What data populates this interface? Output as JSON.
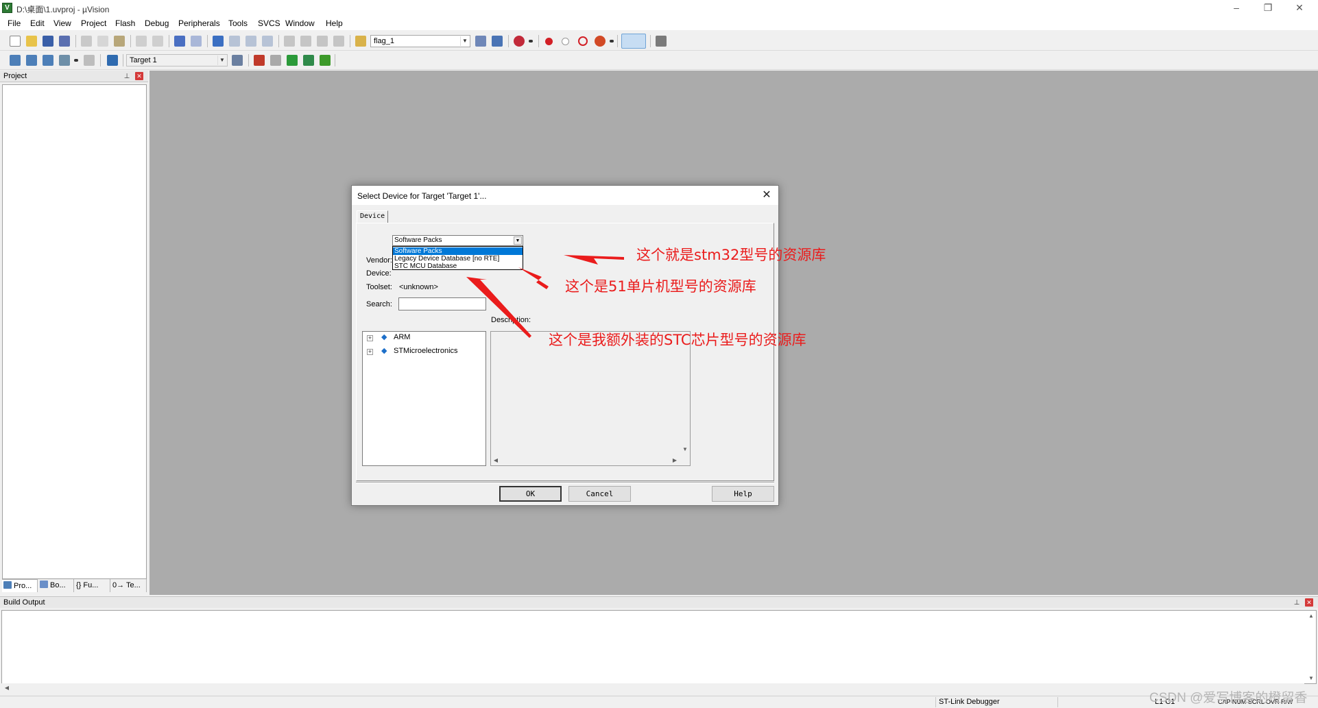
{
  "window": {
    "title": "D:\\桌面\\1.uvproj - µVision",
    "app_icon": "V",
    "controls": {
      "minimize": "–",
      "restore": "❐",
      "close": "✕"
    }
  },
  "menu": [
    "File",
    "Edit",
    "View",
    "Project",
    "Flash",
    "Debug",
    "Peripherals",
    "Tools",
    "SVCS",
    "Window",
    "Help"
  ],
  "toolbar1": {
    "find_combo": "flag_1"
  },
  "toolbar2": {
    "target_combo": "Target 1"
  },
  "project_pane": {
    "title": "Project",
    "tabs": [
      "Pro...",
      "Bo...",
      "{} Fu...",
      "0→ Te..."
    ]
  },
  "build_pane": {
    "title": "Build Output"
  },
  "status_bar": {
    "debugger": "ST-Link Debugger",
    "position": "L1 C1",
    "flags": "CAP  NUM  SCRL  OVR  R/W"
  },
  "dialog": {
    "title": "Select Device for Target 'Target 1'...",
    "tab": "Device",
    "packs_select_value": "Software Packs",
    "packs_options": [
      "Software Packs",
      "Legacy Device Database [no RTE]",
      "STC MCU Database"
    ],
    "selected_option_index": 0,
    "labels": {
      "vendor": "Vendor:",
      "device": "Device:",
      "toolset": "Toolset:",
      "toolset_value": "<unknown>",
      "search": "Search:",
      "description": "Description:"
    },
    "search_value": "",
    "tree": [
      {
        "label": "ARM",
        "icon": "diamond-icon"
      },
      {
        "label": "STMicroelectronics",
        "icon": "diamond-icon"
      }
    ],
    "buttons": {
      "ok": "OK",
      "cancel": "Cancel",
      "help": "Help"
    }
  },
  "annotations": [
    "这个就是stm32型号的资源库",
    "这个是51单片机型号的资源库",
    "这个是我额外装的STC芯片型号的资源库"
  ],
  "watermark": "CSDN @爱写博客的橙留香",
  "colors": {
    "annotation": "#ea1c1c",
    "selection": "#0078d7",
    "workspace": "#ababab"
  }
}
